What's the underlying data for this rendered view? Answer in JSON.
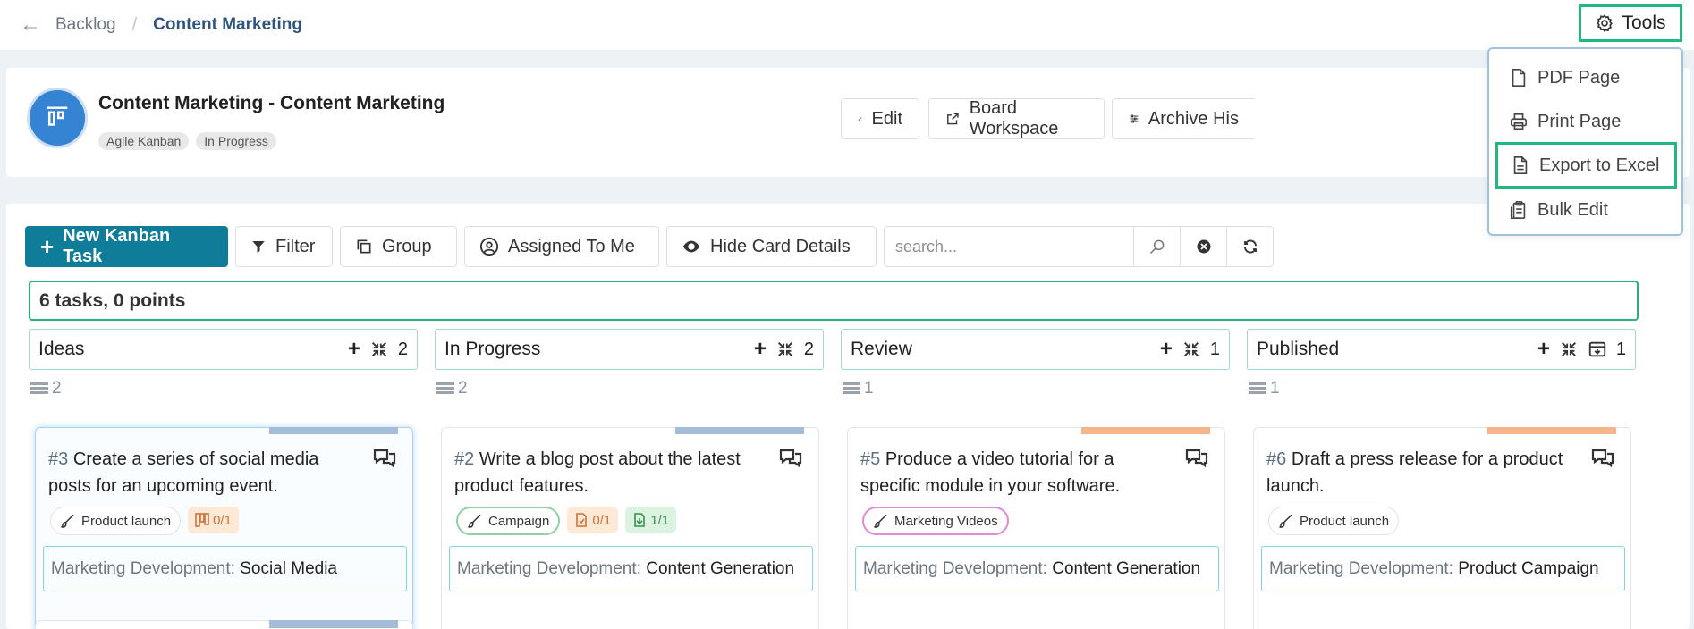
{
  "breadcrumb": {
    "back": "←",
    "parent": "Backlog",
    "separator": "/",
    "current": "Content Marketing"
  },
  "tools": {
    "label": "Tools",
    "menu": [
      {
        "label": "PDF Page",
        "icon": "file-icon"
      },
      {
        "label": "Print Page",
        "icon": "printer-icon"
      },
      {
        "label": "Export to Excel",
        "icon": "file-text-icon"
      },
      {
        "label": "Bulk Edit",
        "icon": "clipboard-icon"
      }
    ]
  },
  "project": {
    "title": "Content Marketing - Content Marketing",
    "badges": [
      "Agile Kanban",
      "In Progress"
    ],
    "buttons": {
      "edit": "Edit",
      "workspace": "Board Workspace",
      "archive": "Archive His"
    }
  },
  "toolbar": {
    "new_task": "New Kanban Task",
    "filter": "Filter",
    "group": "Group",
    "assigned": "Assigned To Me",
    "hide_details": "Hide Card Details",
    "search_placeholder": "search..."
  },
  "summary": "6 tasks, 0 points",
  "columns": [
    {
      "name": "Ideas",
      "count": "2",
      "card_count": "2",
      "card": {
        "num": "#3",
        "title": "Create a series of social media posts for an upcoming event.",
        "bar_color": "#a3bcd8",
        "tag": "Product launch",
        "minis": [
          {
            "text": "0/1",
            "style": "orange",
            "icon": "kanban-icon"
          }
        ],
        "field_label": "Marketing Development:",
        "field_value": "Social Media"
      }
    },
    {
      "name": "In Progress",
      "count": "2",
      "card_count": "2",
      "card": {
        "num": "#2",
        "title": "Write a blog post about the latest product features.",
        "bar_color": "#a3bcd8",
        "tag": "Campaign",
        "minis": [
          {
            "text": "0/1",
            "style": "orange",
            "icon": "file-icon"
          },
          {
            "text": "1/1",
            "style": "lgreen",
            "icon": "download-icon"
          }
        ],
        "field_label": "Marketing Development:",
        "field_value": "Content Generation"
      }
    },
    {
      "name": "Review",
      "count": "1",
      "card_count": "1",
      "card": {
        "num": "#5",
        "title": "Produce a video tutorial for a specific module in your software.",
        "bar_color": "#f5b48a",
        "tag": "Marketing Videos",
        "minis": [],
        "field_label": "Marketing Development:",
        "field_value": "Content Generation"
      }
    },
    {
      "name": "Published",
      "count": "1",
      "card_count": "1",
      "card": {
        "num": "#6",
        "title": "Draft a press release for a product launch.",
        "bar_color": "#f5b48a",
        "tag": "Product launch",
        "minis": [],
        "field_label": "Marketing Development:",
        "field_value": "Product Campaign"
      }
    }
  ]
}
